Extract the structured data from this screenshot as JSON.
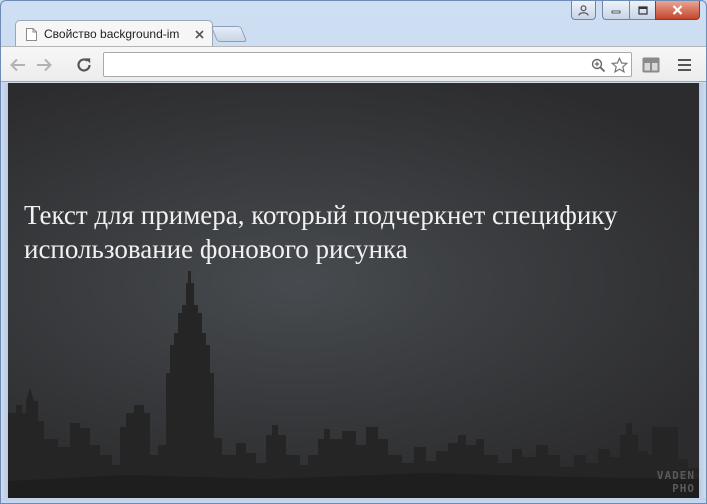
{
  "window": {
    "tab_title": "Свойство background-im",
    "controls": {
      "profile_icon": "person-icon",
      "minimize_icon": "minimize-icon",
      "maximize_icon": "maximize-icon",
      "close_icon": "close-icon"
    }
  },
  "toolbar": {
    "back_icon": "arrow-left-icon",
    "forward_icon": "arrow-right-icon",
    "reload_icon": "reload-icon",
    "address_value": "",
    "zoom_icon": "zoom-icon",
    "bookmark_icon": "star-icon",
    "extension_icon": "extension-icon",
    "menu_icon": "hamburger-menu-icon"
  },
  "page": {
    "text": "Текст для примера, который подчеркнет специфику использование фонового рисунка",
    "watermark_line1": "VADEN",
    "watermark_line2": "PHO"
  },
  "colors": {
    "page_text": "#f1f1f1",
    "sky": "#3a3c3f",
    "skyline": "#252525",
    "close_button": "#c4462b"
  }
}
